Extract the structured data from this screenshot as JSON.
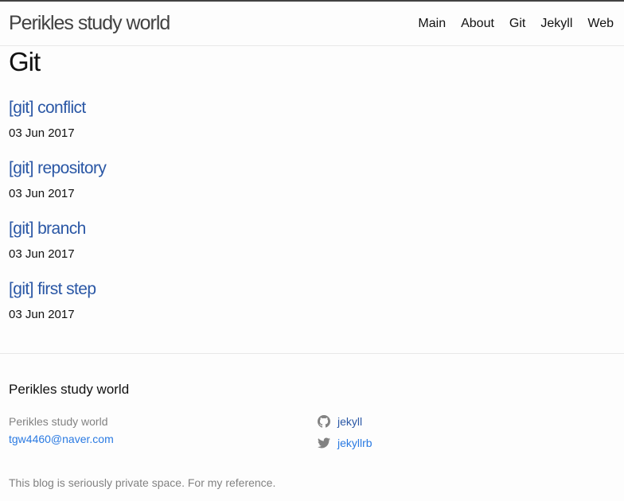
{
  "header": {
    "site_title": "Perikles study world",
    "nav": [
      "Main",
      "About",
      "Git",
      "Jekyll",
      "Web"
    ]
  },
  "page": {
    "heading": "Git"
  },
  "posts": [
    {
      "title": "[git] conflict",
      "date": "03 Jun 2017"
    },
    {
      "title": "[git] repository",
      "date": "03 Jun 2017"
    },
    {
      "title": "[git] branch",
      "date": "03 Jun 2017"
    },
    {
      "title": "[git] first step",
      "date": "03 Jun 2017"
    }
  ],
  "footer": {
    "heading": "Perikles study world",
    "name": "Perikles study world",
    "email": "tgw4460@naver.com",
    "social": [
      {
        "icon": "github-icon",
        "label": "jekyll"
      },
      {
        "icon": "twitter-icon",
        "label": "jekyllrb"
      }
    ],
    "description": "This blog is seriously private space. For my reference."
  },
  "colors": {
    "link": "#2a57a5",
    "muted": "#828282",
    "text": "#111111"
  }
}
